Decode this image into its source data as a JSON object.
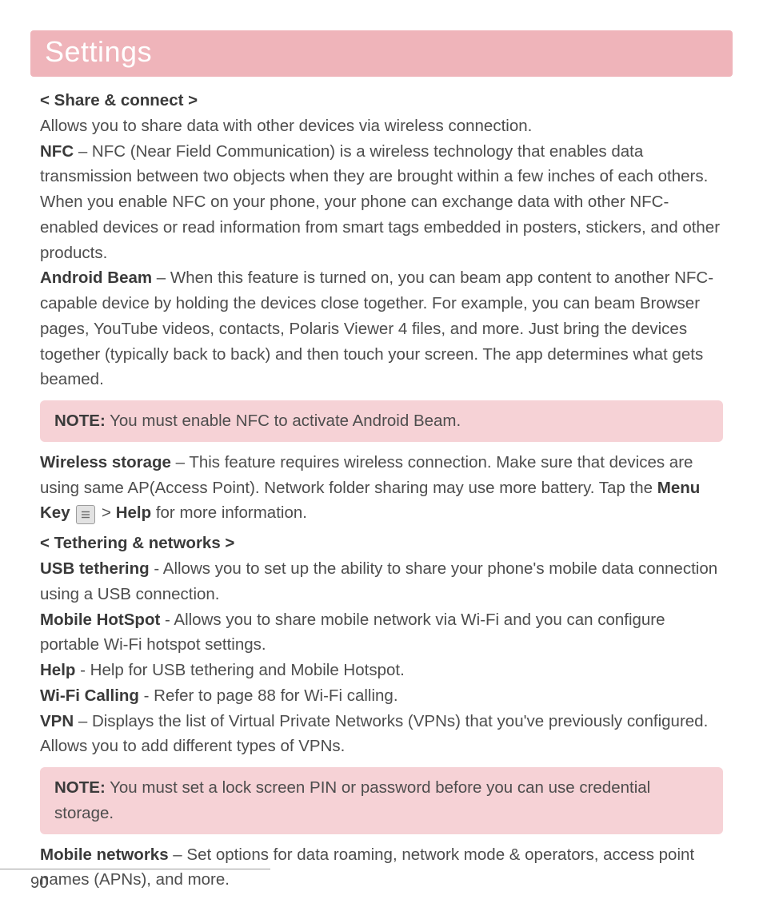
{
  "header": {
    "title": "Settings"
  },
  "sec1": {
    "title": "< Share & connect >",
    "intro": "Allows you to share data with other devices via wireless connection.",
    "nfc_label": "NFC",
    "nfc_text": " – NFC (Near Field Communication) is a wireless technology that enables data transmission between two objects when they are brought within a few inches of each others. When you enable NFC on your phone, your phone can exchange data with other NFC-enabled devices or read information from smart tags embedded in posters, stickers, and other products.",
    "beam_label": "Android Beam",
    "beam_text": " – When this feature is turned on, you can beam app content to another NFC-capable device by holding the devices close together. For example, you can beam Browser pages, YouTube videos, contacts, Polaris Viewer 4 files, and more. Just bring the devices together (typically back to back) and then touch your screen. The app determines what gets beamed."
  },
  "note1": {
    "label": "NOTE:",
    "text": " You must enable NFC to activate Android Beam."
  },
  "wireless": {
    "label": "Wireless storage",
    "text1": " – This feature requires wireless connection. Make sure that devices are using same AP(Access Point). Network folder sharing may use more battery. Tap the ",
    "menu_key": "Menu Key",
    "gt": " > ",
    "help": "Help",
    "text2": " for more information."
  },
  "sec2": {
    "title": "< Tethering & networks >",
    "usb_label": "USB tethering",
    "usb_text": " - Allows you to set up the ability to share your phone's mobile data connection using a USB connection.",
    "hotspot_label": "Mobile HotSpot",
    "hotspot_text": " - Allows you to share mobile network via Wi-Fi and you can configure portable Wi-Fi hotspot settings.",
    "help_label": "Help",
    "help_text": " - Help for USB tethering and Mobile Hotspot.",
    "wifi_label": "Wi-Fi Calling",
    "wifi_text": " - Refer to page 88 for Wi-Fi calling.",
    "vpn_label": "VPN",
    "vpn_text": " – Displays the list of Virtual Private Networks (VPNs) that you've previously configured. Allows you to add different types of VPNs."
  },
  "note2": {
    "label": "NOTE:",
    "text": " You must set a lock screen PIN or password before you can use credential storage."
  },
  "mobile": {
    "label": "Mobile networks",
    "text": " – Set options for data roaming, network mode & operators, access point names (APNs), and more."
  },
  "page_number": "90"
}
